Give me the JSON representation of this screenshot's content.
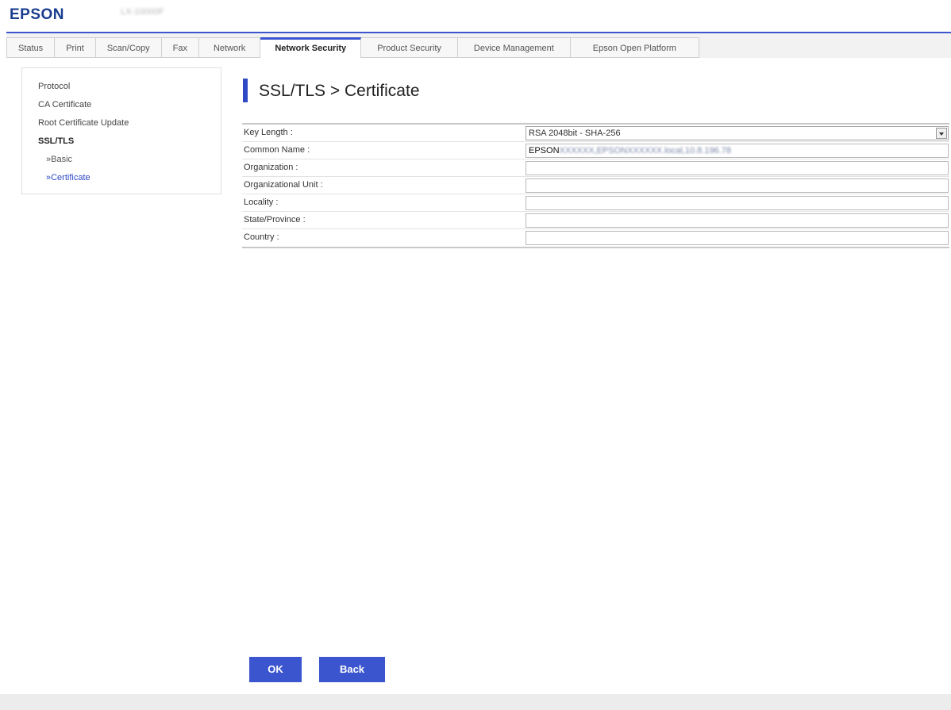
{
  "header": {
    "logo": "EPSON",
    "model": "LX-10000F"
  },
  "tabs": [
    {
      "label": "Status"
    },
    {
      "label": "Print"
    },
    {
      "label": "Scan/Copy"
    },
    {
      "label": "Fax"
    },
    {
      "label": "Network"
    },
    {
      "label": "Network Security",
      "active": true
    },
    {
      "label": "Product Security"
    },
    {
      "label": "Device Management"
    },
    {
      "label": "Epson Open Platform"
    }
  ],
  "sidebar": {
    "items": [
      {
        "label": "Protocol"
      },
      {
        "label": "CA Certificate"
      },
      {
        "label": "Root Certificate Update"
      },
      {
        "label": "SSL/TLS"
      },
      {
        "label": "»Basic"
      },
      {
        "label": "»Certificate"
      }
    ]
  },
  "page": {
    "title": "SSL/TLS > Certificate"
  },
  "form": {
    "key_length": {
      "label": "Key Length :",
      "value": "RSA 2048bit - SHA-256"
    },
    "common_name": {
      "label": "Common Name :",
      "value_prefix": "EPSON",
      "value_blurred": "XXXXXX,EPSONXXXXXX.local,10.8.196.78"
    },
    "organization": {
      "label": "Organization :",
      "value": ""
    },
    "organizational_unit": {
      "label": "Organizational Unit :",
      "value": ""
    },
    "locality": {
      "label": "Locality :",
      "value": ""
    },
    "state_province": {
      "label": "State/Province :",
      "value": ""
    },
    "country": {
      "label": "Country :",
      "value": ""
    }
  },
  "buttons": {
    "ok": "OK",
    "back": "Back"
  },
  "colors": {
    "accent": "#3b55cf",
    "brand": "#1a3d8f"
  }
}
